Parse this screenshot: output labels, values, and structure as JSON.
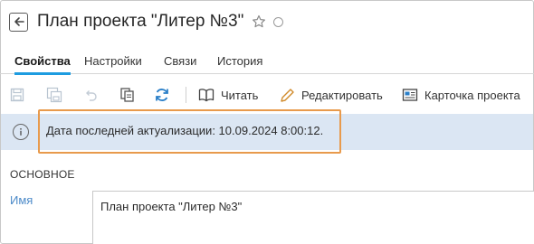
{
  "header": {
    "title": "План проекта \"Литер №3\""
  },
  "tabs": [
    {
      "label": "Свойства",
      "active": true
    },
    {
      "label": "Настройки"
    },
    {
      "label": "Связи"
    },
    {
      "label": "История"
    }
  ],
  "toolbar": {
    "read_label": "Читать",
    "edit_label": "Редактировать",
    "card_label": "Карточка проекта"
  },
  "info": {
    "text": "Дата последней актуализации: 10.09.2024 8:00:12."
  },
  "section": {
    "title": "ОСНОВНОЕ"
  },
  "fields": {
    "name_label": "Имя",
    "name_value": "План проекта \"Литер №3\""
  },
  "colors": {
    "accent": "#1e9ce0",
    "info_bg": "#dbe6f3",
    "highlight": "#e89a4c",
    "label": "#4d8bc9"
  }
}
